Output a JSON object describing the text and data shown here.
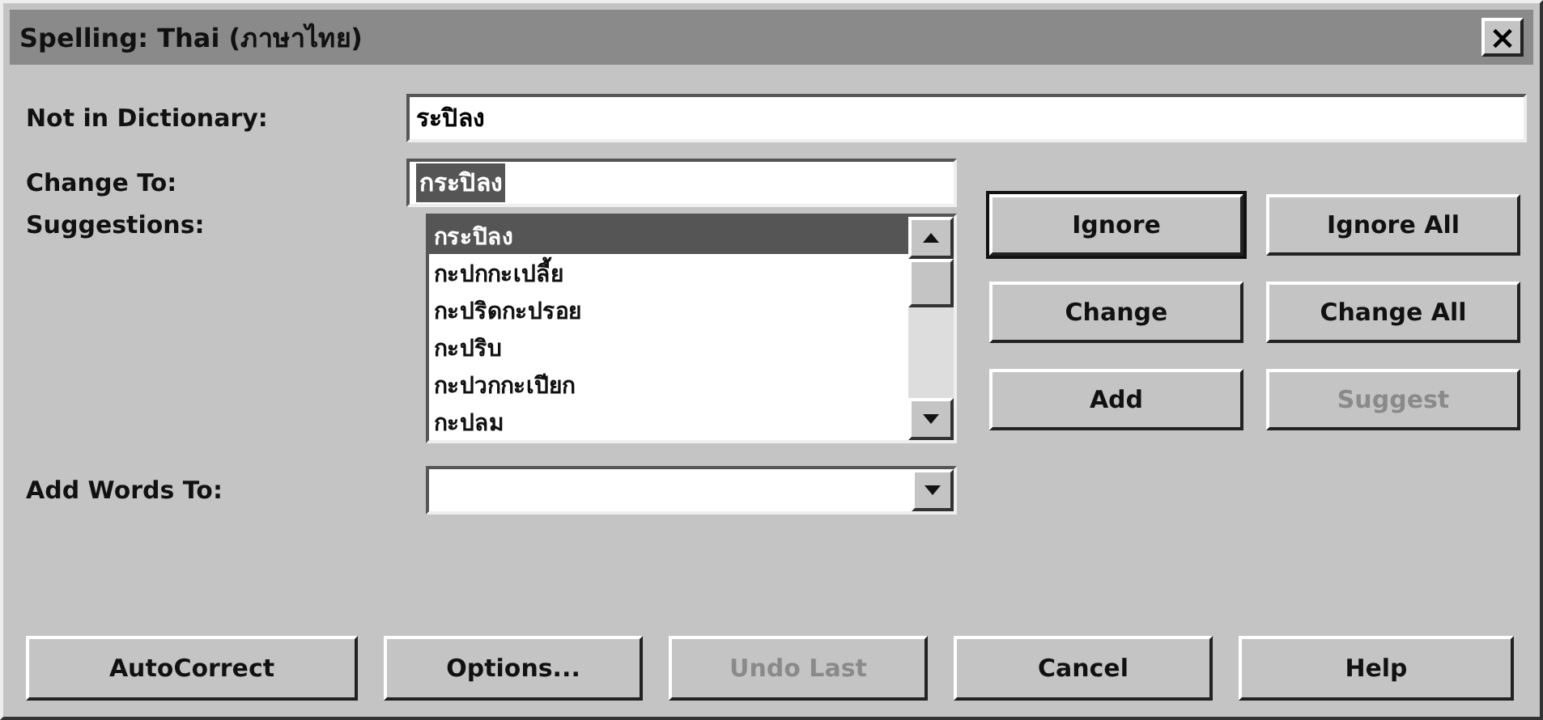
{
  "window": {
    "title": "Spelling: Thai (ภาษาไทย)",
    "close": "×"
  },
  "not_in_dictionary": {
    "label": "Not in Dictionary:",
    "value": "ระปิลง"
  },
  "change_to": {
    "label": "Change To:",
    "value": "กระปิลง",
    "selected": true
  },
  "suggestions": {
    "label": "Suggestions:",
    "items": [
      {
        "text": "กระปิลง",
        "selected": true
      },
      {
        "text": "กะปกกะเปลี้ย",
        "selected": false
      },
      {
        "text": "กะปริดกะปรอย",
        "selected": false
      },
      {
        "text": "กะปริบ",
        "selected": false
      },
      {
        "text": "กะปวกกะเปียก",
        "selected": false
      },
      {
        "text": "กะปลม",
        "selected": false
      }
    ]
  },
  "side_buttons": [
    {
      "label": "Ignore",
      "disabled": false,
      "default": true
    },
    {
      "label": "Ignore All",
      "disabled": false,
      "default": false
    },
    {
      "label": "Change",
      "disabled": false,
      "default": false
    },
    {
      "label": "Change All",
      "disabled": false,
      "default": false
    },
    {
      "label": "Add",
      "disabled": false,
      "default": false
    },
    {
      "label": "Suggest",
      "disabled": true,
      "default": false
    }
  ],
  "add_words_to": {
    "label": "Add Words To:"
  },
  "bottom_buttons": [
    {
      "label": "AutoCorrect",
      "disabled": false
    },
    {
      "label": "Options...",
      "disabled": false
    },
    {
      "label": "Undo Last",
      "disabled": true
    },
    {
      "label": "Cancel",
      "disabled": false
    },
    {
      "label": "Help",
      "disabled": false
    }
  ]
}
